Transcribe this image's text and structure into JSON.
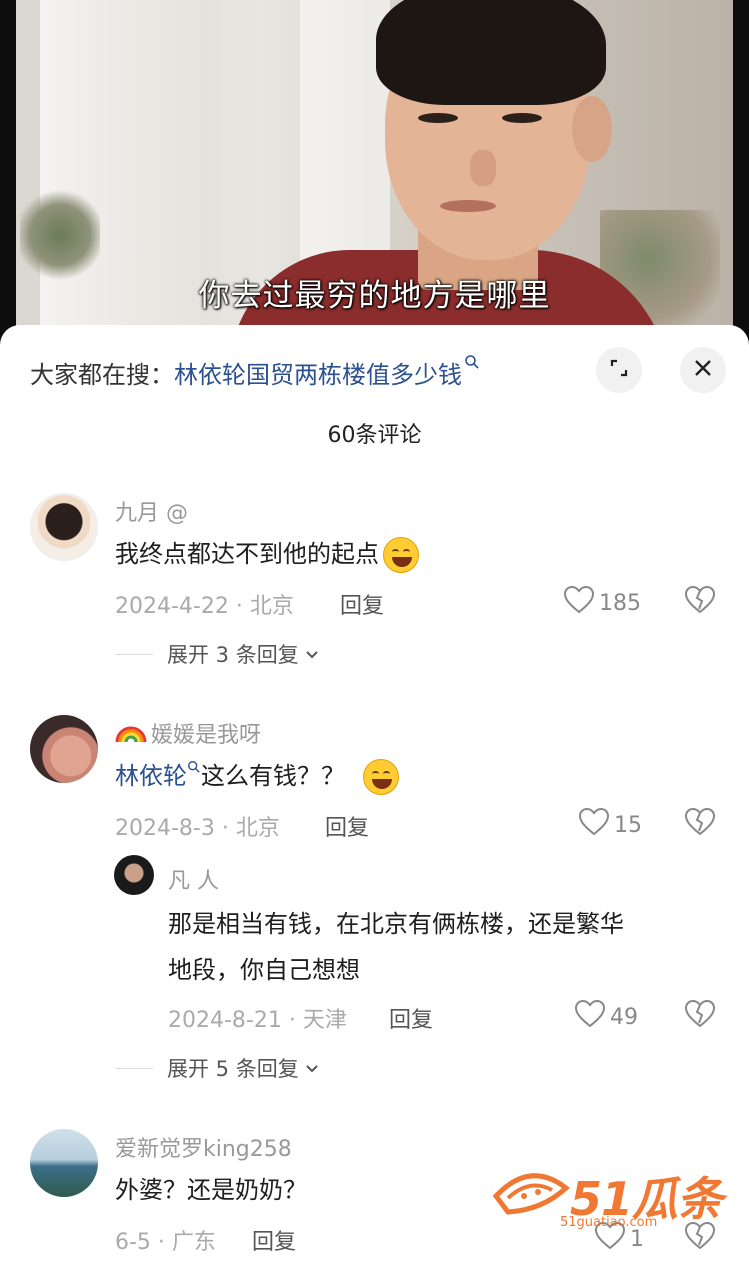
{
  "video": {
    "subtitle": "你去过最穷的地方是哪里"
  },
  "search": {
    "prefix": "大家都在搜：",
    "query": "林依轮国贸两栋楼值多少钱"
  },
  "comments_count": "60条评论",
  "comments": [
    {
      "username": "九月 @",
      "text": "我终点都达不到他的起点",
      "meta": "2024-4-22 · 北京",
      "reply_label": "回复",
      "likes": "185",
      "expand": "展开 3 条回复"
    },
    {
      "username": "媛媛是我呀",
      "text_link": "林依轮",
      "text_rest": "这么有钱？？",
      "meta": "2024-8-3 · 北京",
      "reply_label": "回复",
      "likes": "15",
      "sub_reply": {
        "username": "凡  人",
        "text_line1": "那是相当有钱，在北京有俩栋楼，还是繁华",
        "text_line2": "地段，你自己想想",
        "meta": "2024-8-21 · 天津",
        "reply_label": "回复",
        "likes": "49"
      },
      "expand": "展开 5 条回复"
    },
    {
      "username": "爱新觉罗king258",
      "text": "外婆？还是奶奶？",
      "meta": "6-5 · 广东",
      "reply_label": "回复",
      "likes": "1"
    }
  ],
  "watermark": {
    "brand": "51瓜条",
    "domain": "51guatiao.com"
  },
  "colors": {
    "link": "#2c5190",
    "watermark": "#f06a1e"
  }
}
